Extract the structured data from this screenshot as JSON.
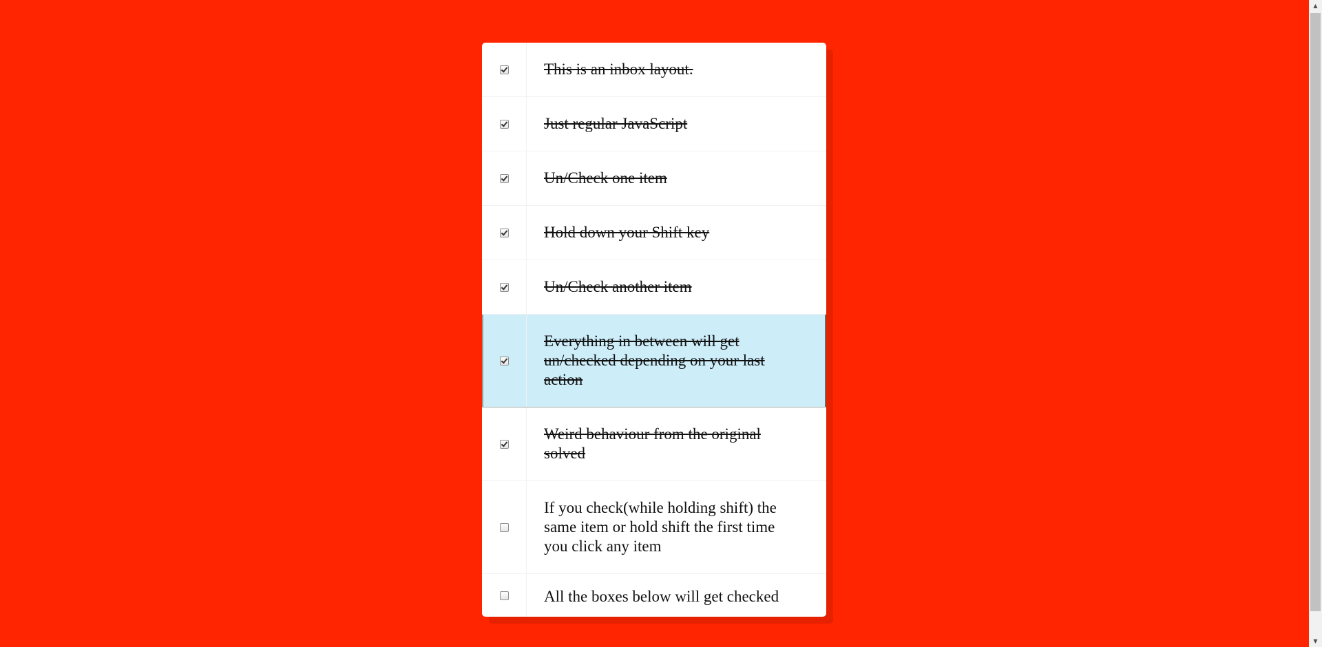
{
  "inbox": {
    "items": [
      {
        "label": "This is an inbox layout.",
        "checked": true
      },
      {
        "label": "Just regular JavaScript",
        "checked": true
      },
      {
        "label": "Un/Check one item",
        "checked": true
      },
      {
        "label": "Hold down your Shift key",
        "checked": true
      },
      {
        "label": "Un/Check another item",
        "checked": true
      },
      {
        "label": "Everything in between will get un/checked depending on your last action",
        "checked": true
      },
      {
        "label": "Weird behaviour from the original solved",
        "checked": true
      },
      {
        "label": "If you check(while holding shift) the same item or hold shift the first time you click any item",
        "checked": false
      },
      {
        "label": "All the boxes below will get checked",
        "checked": false
      }
    ]
  },
  "scrollbar": {
    "up_icon": "▲",
    "down_icon": "▼"
  },
  "colors": {
    "background": "#ff2500",
    "active_row": "#cdedf9"
  }
}
